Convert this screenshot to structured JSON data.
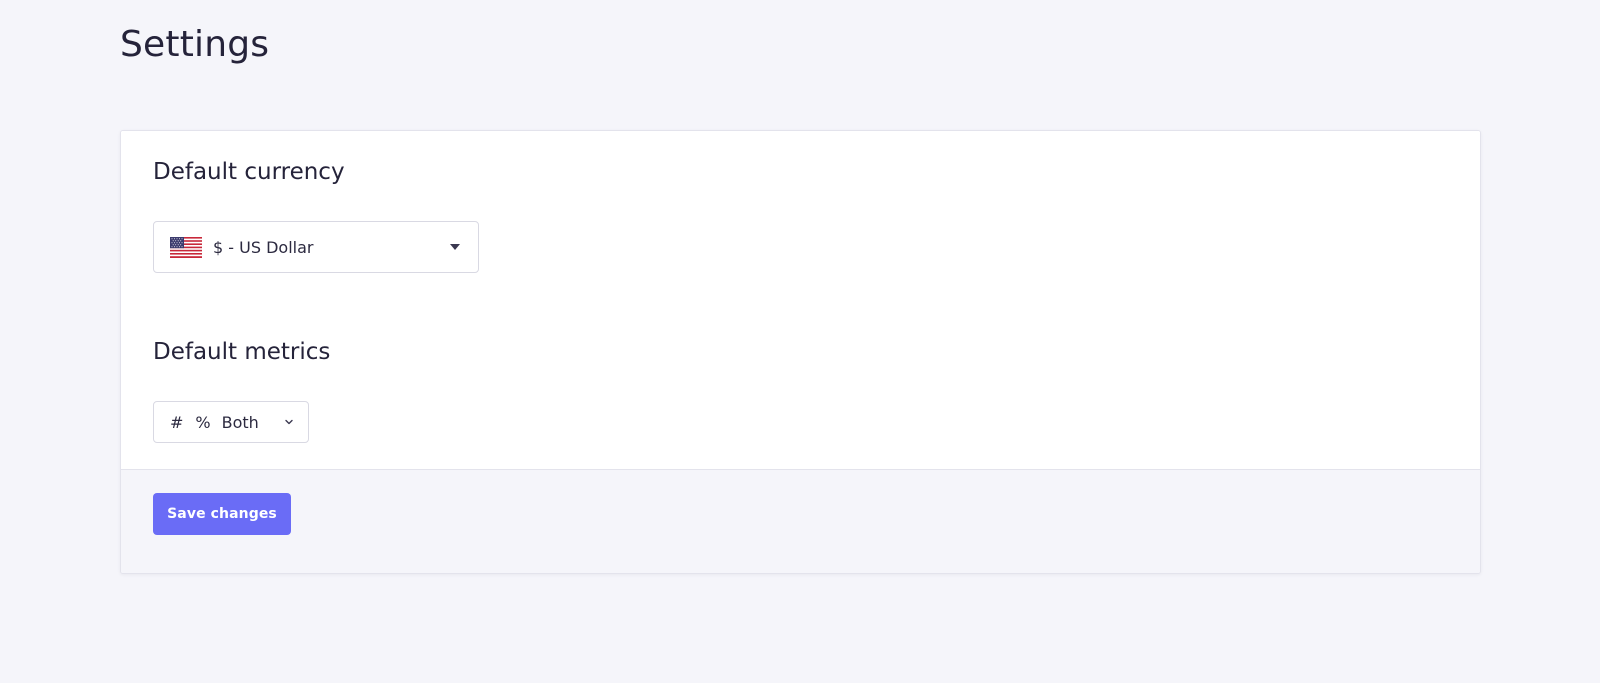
{
  "page": {
    "title": "Settings"
  },
  "currency": {
    "label": "Default currency",
    "selected": "$ - US Dollar",
    "flag_icon": "us-flag-icon"
  },
  "metrics": {
    "label": "Default metrics",
    "hash_symbol": "#",
    "percent_symbol": "%",
    "selected": "Both"
  },
  "footer": {
    "save_label": "Save changes"
  },
  "colors": {
    "background": "#f5f5fa",
    "card": "#ffffff",
    "accent": "#6a6cf6",
    "text": "#25233a"
  }
}
